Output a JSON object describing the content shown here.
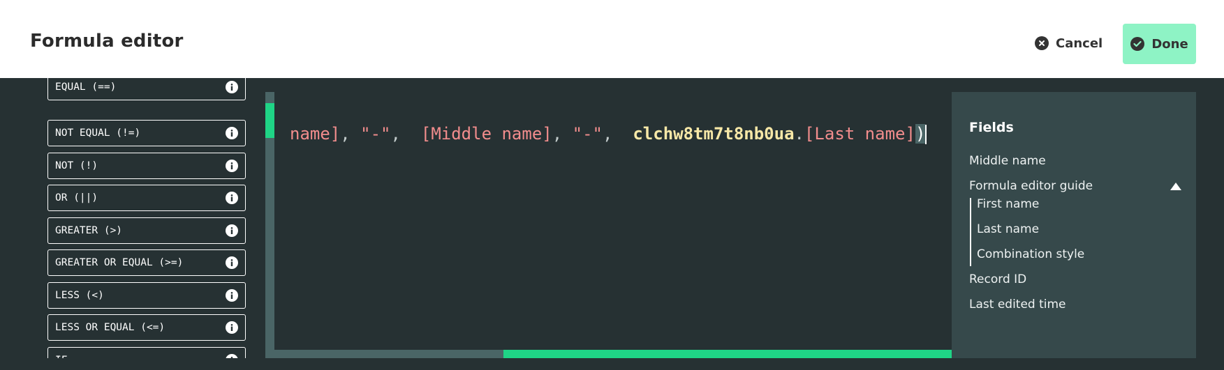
{
  "header": {
    "title": "Formula editor",
    "cancel_label": "Cancel",
    "done_label": "Done"
  },
  "functions": [
    {
      "label": "EQUAL (==)"
    },
    {
      "label": "NOT EQUAL (!=)"
    },
    {
      "label": "NOT (!)"
    },
    {
      "label": "OR (||)"
    },
    {
      "label": "GREATER (>)"
    },
    {
      "label": "GREATER OR EQUAL (>=)"
    },
    {
      "label": "LESS (<)"
    },
    {
      "label": "LESS OR EQUAL (<=)"
    },
    {
      "label": "IF"
    }
  ],
  "editor": {
    "tokens": {
      "t1": "name]",
      "t2": ", ",
      "t3": "\"-\"",
      "t4": ",  ",
      "t5": "[Middle name]",
      "t6": ", ",
      "t7": "\"-\"",
      "t8": ",  ",
      "t9": "clchw8tm7t8nb0ua",
      "t10": ".",
      "t11": "[Last name]",
      "t12": ")"
    }
  },
  "fields_panel": {
    "title": "Fields",
    "items": {
      "middle_name": "Middle name",
      "guide": "Formula editor guide",
      "first_name": "First name",
      "last_name": "Last name",
      "combination_style": "Combination style",
      "record_id": "Record ID",
      "last_edited_time": "Last edited time"
    }
  },
  "colors": {
    "accent": "#1fd486",
    "done_bg": "#8ef3c5",
    "background": "#263133",
    "panel": "#36494b"
  },
  "icons": {
    "cancel": "close-circle-icon",
    "done": "check-circle-icon",
    "info": "info-icon",
    "collapse": "triangle-up-icon"
  }
}
